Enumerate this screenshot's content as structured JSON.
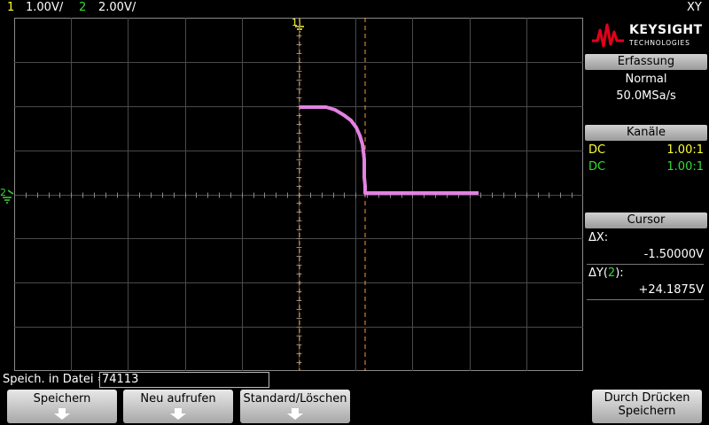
{
  "header": {
    "ch1_num": "1",
    "ch1_scale": "1.00V/",
    "ch2_num": "2",
    "ch2_scale": "2.00V/",
    "mode": "XY"
  },
  "logo": {
    "brand": "KEYSIGHT",
    "sub": "TECHNOLOGIES"
  },
  "markers": {
    "ch1_marker": "1",
    "ch2_marker": "2"
  },
  "acquisition": {
    "title": "Erfassung",
    "mode": "Normal",
    "rate": "50.0MSa/s"
  },
  "channels": {
    "title": "Kanäle",
    "items": [
      {
        "coupling": "DC",
        "probe": "1.00:1"
      },
      {
        "coupling": "DC",
        "probe": "1.00:1"
      }
    ]
  },
  "cursor": {
    "title": "Cursor",
    "dx_label": "ΔX:",
    "dx_value": "-1.50000V",
    "dy_label_pre": "ΔY(",
    "dy_label_ch": "2",
    "dy_label_post": "):",
    "dy_value": "+24.1875V"
  },
  "status": {
    "label": "Speich. in Datei =",
    "filename": "74113"
  },
  "softkeys": {
    "save": "Speichern",
    "recall": "Neu aufrufen",
    "default_clear": "Standard/Löschen",
    "press_save_1": "Durch Drücken",
    "press_save_2": "Speichern"
  },
  "colors": {
    "ch1": "#ffff33",
    "ch2": "#33dd33",
    "trace": "#ee88ee",
    "cursor": "#ff9933",
    "logo_red": "#e3001b"
  }
}
